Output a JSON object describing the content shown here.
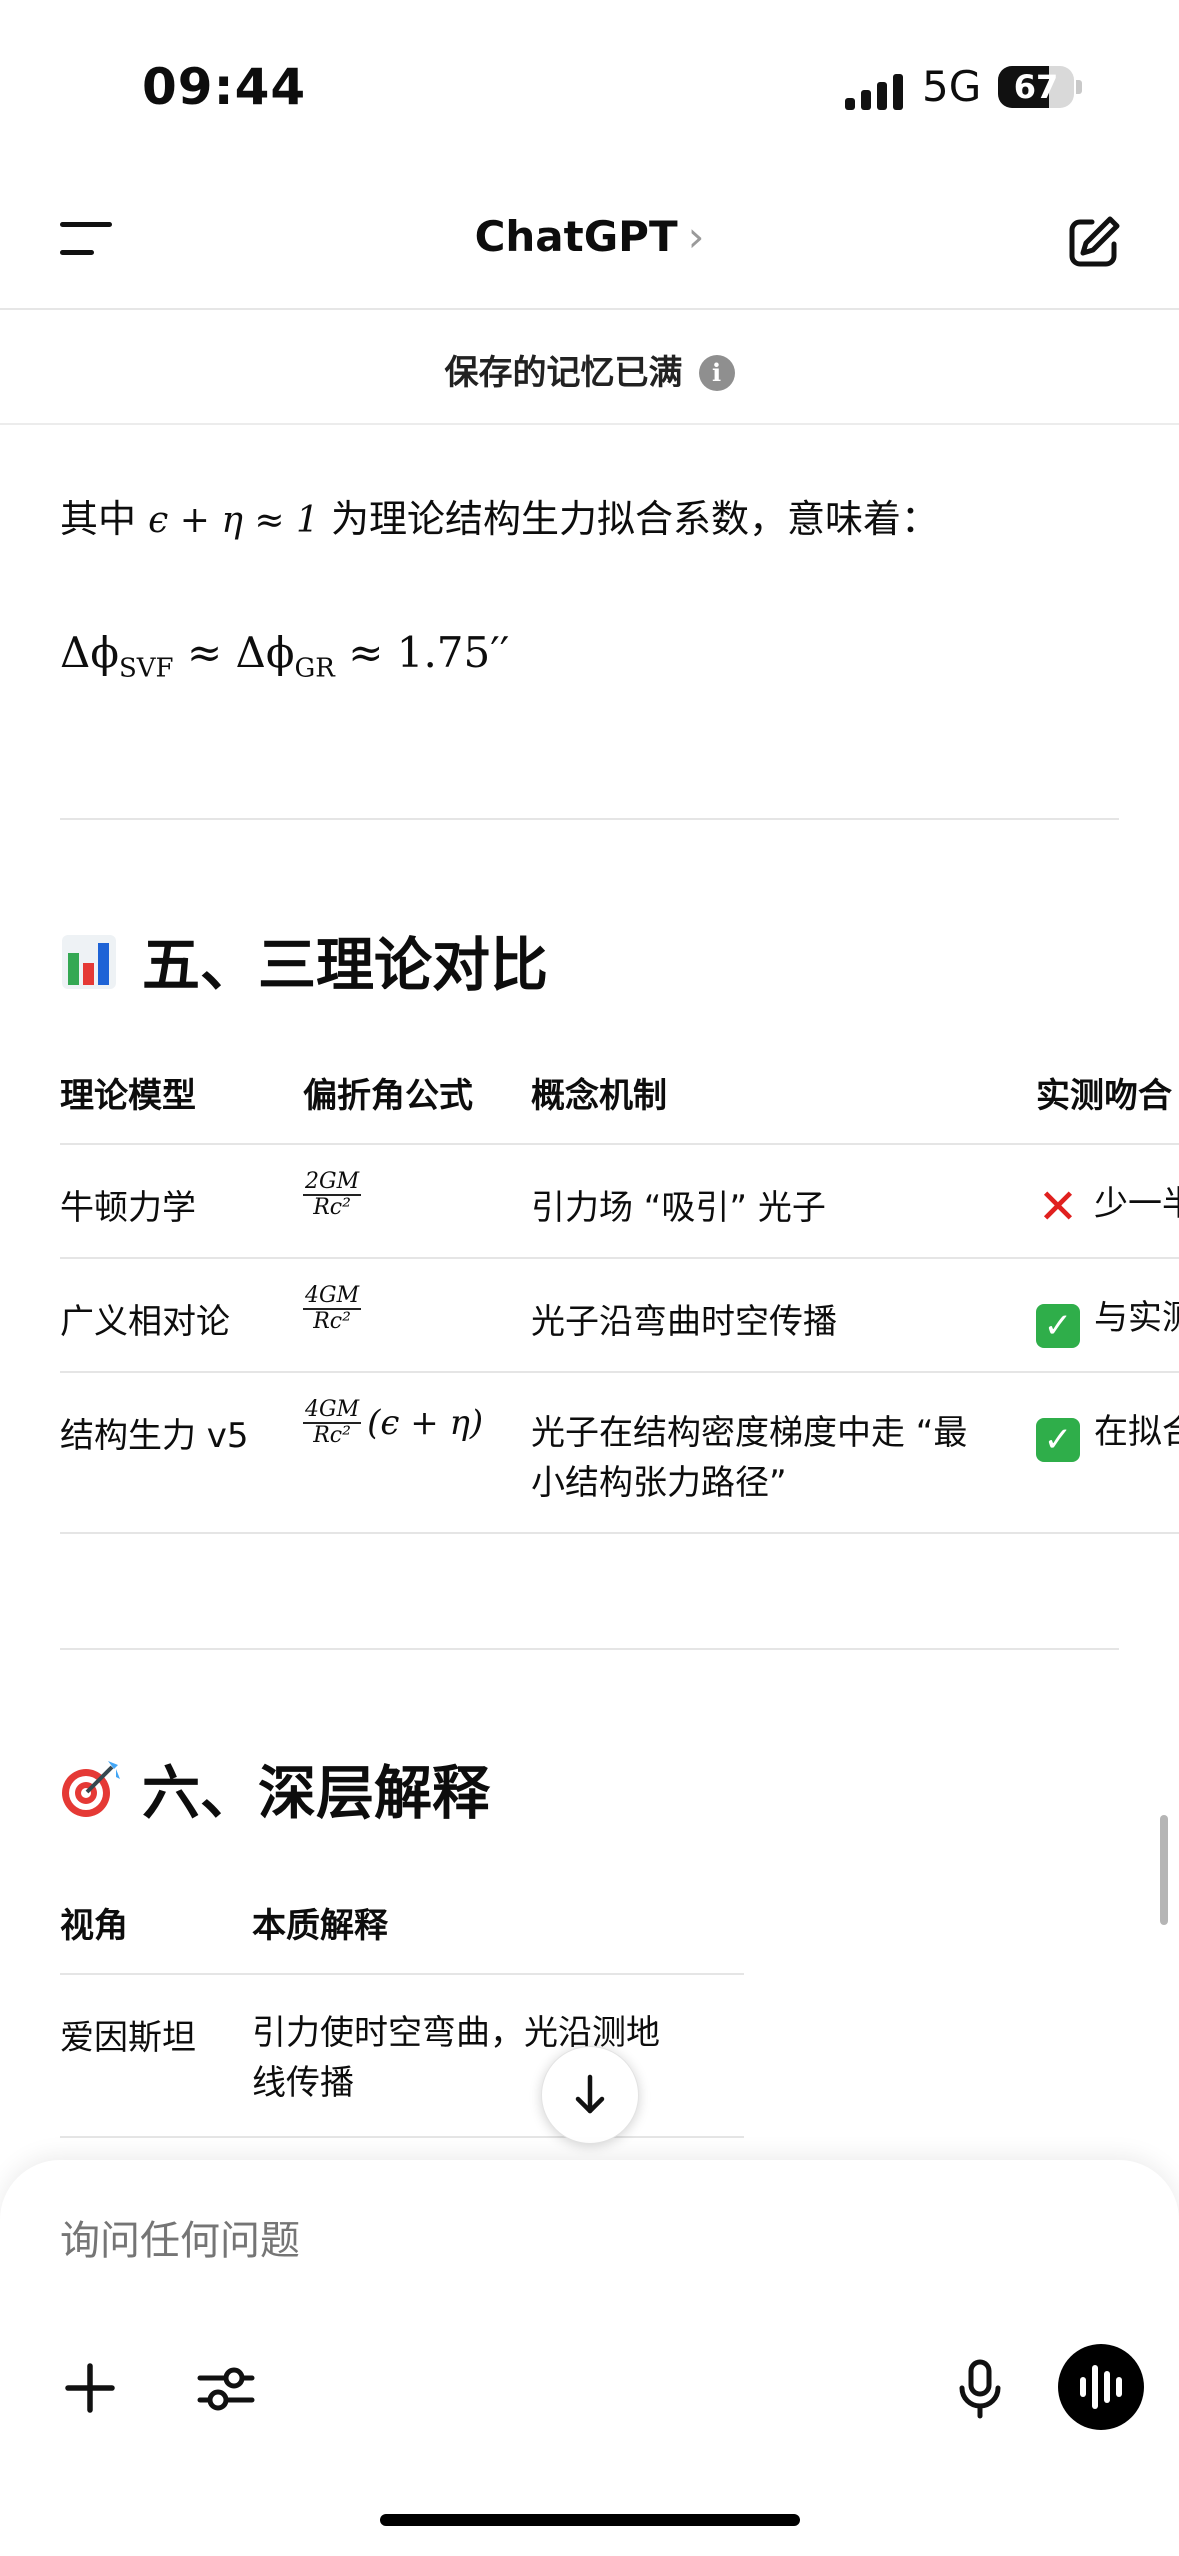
{
  "status": {
    "time": "09:44",
    "network": "5G",
    "battery": "67",
    "battery_level": 0.67
  },
  "header": {
    "title": "ChatGPT",
    "chevron": "›",
    "menu_icon": "menu-icon",
    "edit_icon": "compose-icon"
  },
  "memory_banner": {
    "text": "保存的记忆已满",
    "info_glyph": "i"
  },
  "content": {
    "para_prefix": "其中",
    "para_math": "ϵ + η ≈ 1",
    "para_suffix": "为理论结构生力拟合系数，意味着：",
    "equation": {
      "delta1": "Δϕ",
      "sub1": "SVF",
      "approx1": " ≈ ",
      "delta2": "Δϕ",
      "sub2": "GR",
      "rest": " ≈ 1.75′′"
    },
    "section5": {
      "emoji": "bar-chart-emoji",
      "title": "五、三理论对比",
      "headers": [
        "理论模型",
        "偏折角公式",
        "概念机制",
        "实测吻合"
      ],
      "rows": [
        {
          "model": "牛顿力学",
          "frac_num": "2GM",
          "frac_den": "Rc²",
          "frac_tail": "",
          "mechanism": "引力场 “吸引” 光子",
          "mechanism2": "",
          "fit_icon": "cross-mark",
          "fit": "少一半"
        },
        {
          "model": "广义相对论",
          "frac_num": "4GM",
          "frac_den": "Rc²",
          "frac_tail": "",
          "mechanism": "光子沿弯曲时空传播",
          "mechanism2": "",
          "fit_icon": "check-mark",
          "fit": "与实测"
        },
        {
          "model": "结构生力 v5",
          "frac_num": "4GM",
          "frac_den": "Rc²",
          "frac_tail": "(ϵ + η)",
          "mechanism": "光子在结构密度梯度中走 “最",
          "mechanism2": "小结构张力路径”",
          "fit_icon": "check-mark",
          "fit": "在拟合"
        }
      ],
      "fit_glyphs": {
        "cross": "✕",
        "check": "✓"
      }
    },
    "section6": {
      "emoji": "dart-target-emoji",
      "title": "六、深层解释",
      "headers": [
        "视角",
        "本质解释"
      ],
      "rows": [
        {
          "view": "爱因斯坦",
          "explain": "引力使时空弯曲，光沿测地",
          "explain2": "线传播"
        }
      ]
    }
  },
  "composer": {
    "placeholder": "询问任何问题"
  },
  "colors": {
    "check": "#2fae4a",
    "cross": "#e0201f",
    "divider": "#e5e5e5"
  }
}
